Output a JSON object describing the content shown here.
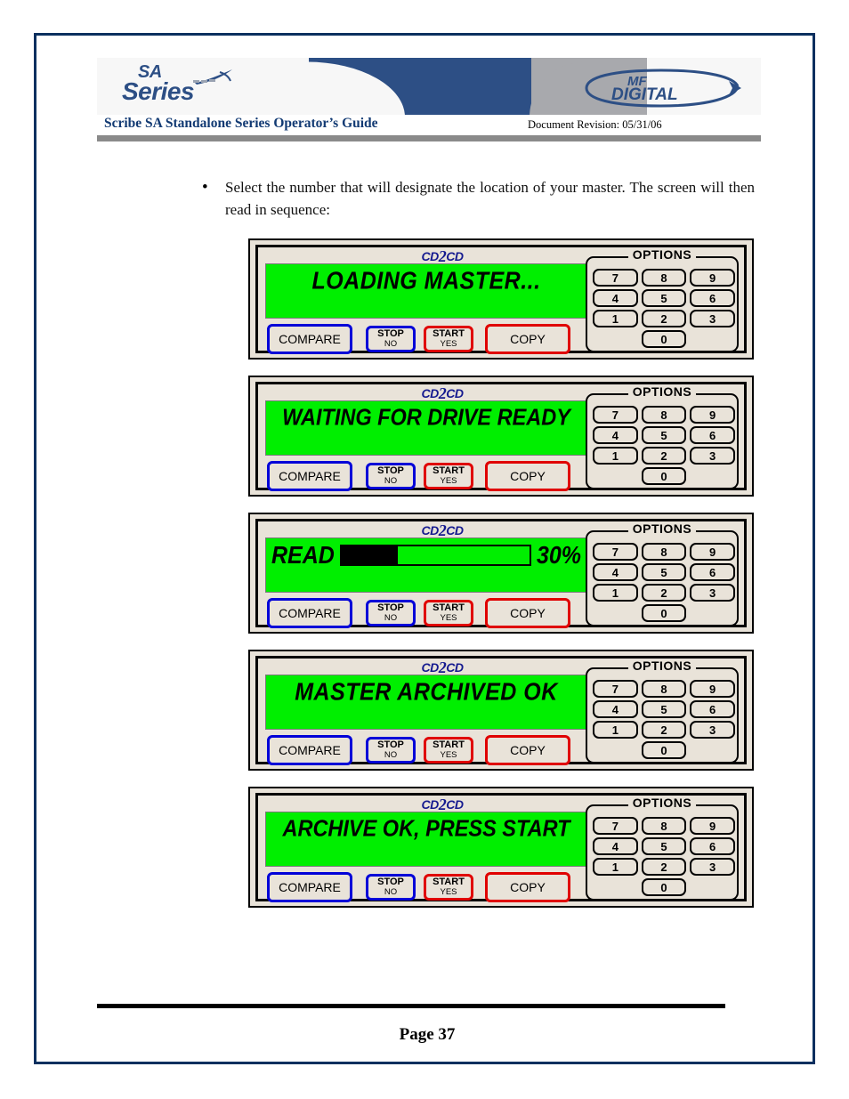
{
  "document": {
    "header": {
      "brand_logo_line1": "SA",
      "brand_logo_line2": "Series",
      "company_logo_line1": "MF",
      "company_logo_line2": "DIGITAL",
      "title": "Scribe SA Standalone Series Operator’s Guide",
      "revision": "Document Revision: 05/31/06"
    },
    "body": {
      "bullet_marker": "•",
      "bullet_text": "Select the number that will designate the location of your master. The screen will then read in sequence:"
    },
    "footer": {
      "page_number": "Page 37"
    }
  },
  "device_common": {
    "brand_prefix": "CD",
    "brand_mid": "2",
    "brand_suffix": "CD",
    "buttons": {
      "compare": "COMPARE",
      "stop_top": "STOP",
      "stop_bottom": "NO",
      "start_top": "START",
      "start_bottom": "YES",
      "copy": "COPY"
    },
    "keypad": {
      "title": "OPTIONS",
      "keys": [
        "7",
        "8",
        "9",
        "4",
        "5",
        "6",
        "1",
        "2",
        "3"
      ],
      "zero_key": "0"
    },
    "colors": {
      "lcd_background": "#00ef00",
      "lcd_text": "#000000",
      "chassis": "#e9e3d9",
      "blue_button_border": "#0000d8",
      "red_button_border": "#e00000",
      "brand_text": "#151a8f"
    }
  },
  "devices": [
    {
      "id": "panel-1",
      "display_mode": "text",
      "lcd_text": "LOADING MASTER..."
    },
    {
      "id": "panel-2",
      "display_mode": "text",
      "lcd_text": "WAITING FOR DRIVE READY"
    },
    {
      "id": "panel-3",
      "display_mode": "progress",
      "lcd_label": "READ",
      "lcd_percent_label": "30%",
      "lcd_percent_value": 30
    },
    {
      "id": "panel-4",
      "display_mode": "text",
      "lcd_text": "MASTER ARCHIVED OK"
    },
    {
      "id": "panel-5",
      "display_mode": "text",
      "lcd_text": "ARCHIVE OK, PRESS START"
    }
  ]
}
